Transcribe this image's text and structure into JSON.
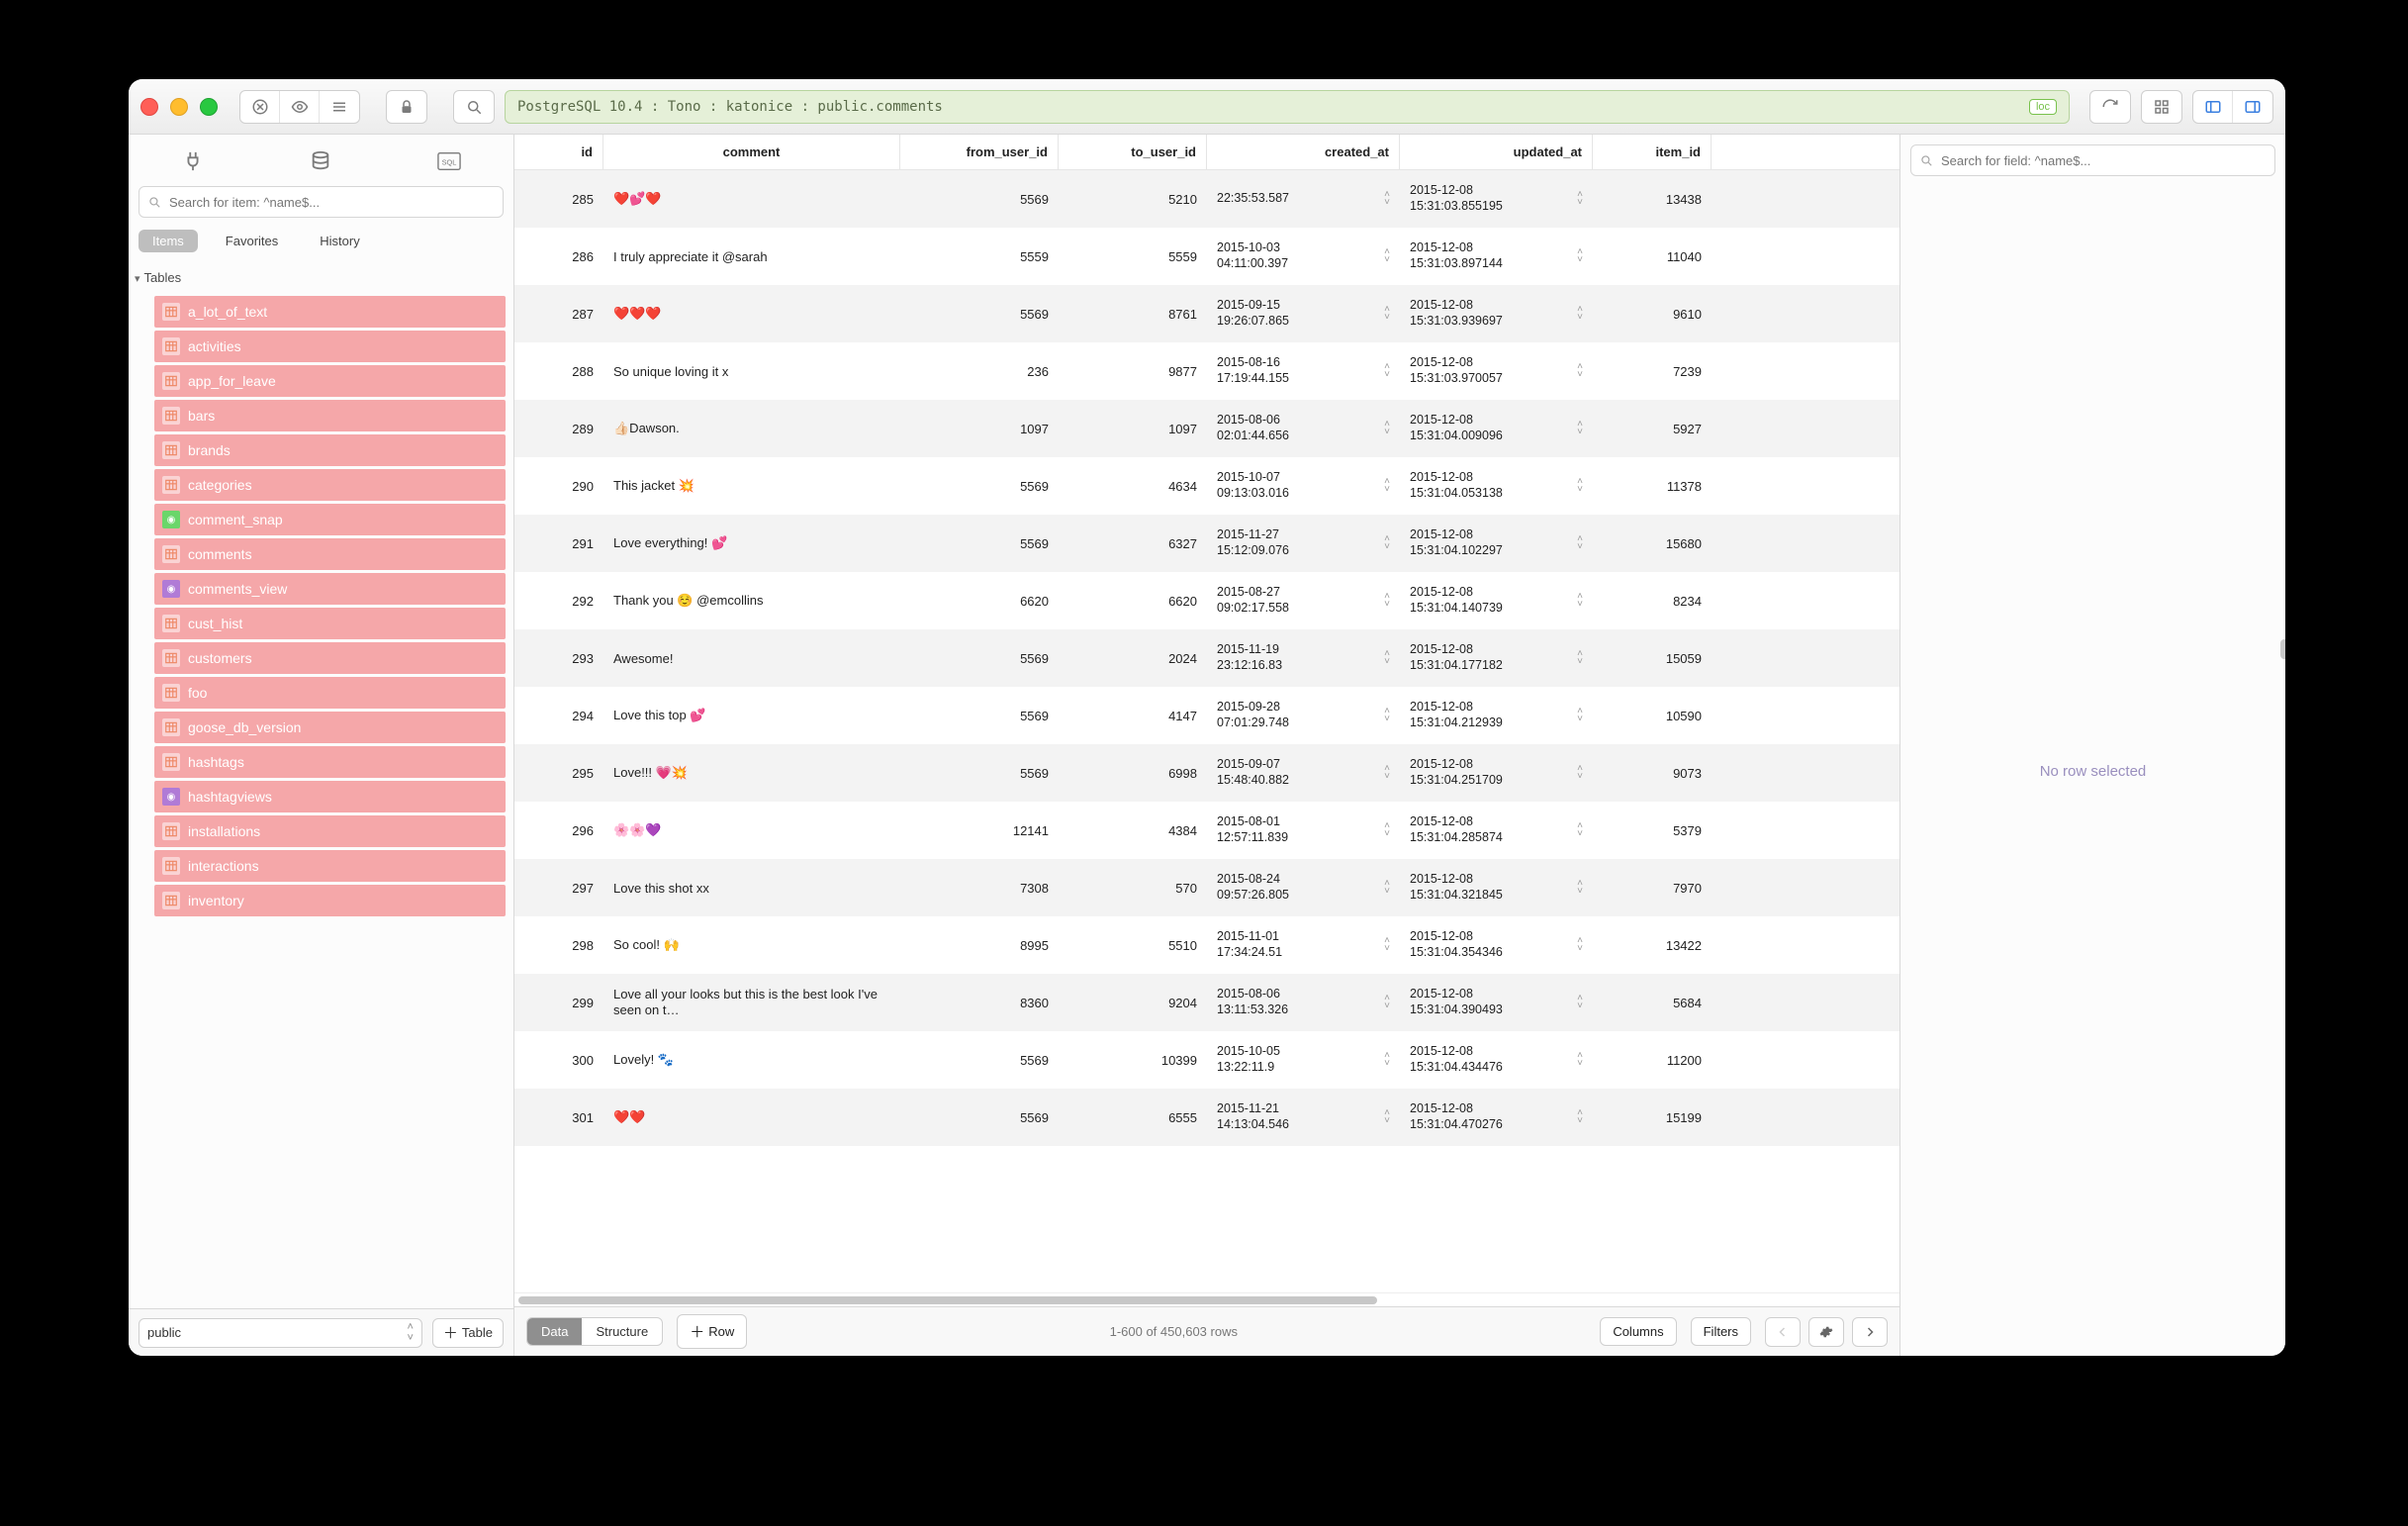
{
  "titlebar": {
    "connection": "PostgreSQL 10.4 : Tono : katonice : public.comments",
    "badge": "loc"
  },
  "sidebar": {
    "search_placeholder": "Search for item: ^name$...",
    "tabs": {
      "items": "Items",
      "favorites": "Favorites",
      "history": "History"
    },
    "section": "Tables",
    "schema": "public",
    "add_table": "Table",
    "tables": [
      {
        "name": "a_lot_of_text",
        "kind": "table"
      },
      {
        "name": "activities",
        "kind": "table"
      },
      {
        "name": "app_for_leave",
        "kind": "table"
      },
      {
        "name": "bars",
        "kind": "table"
      },
      {
        "name": "brands",
        "kind": "table"
      },
      {
        "name": "categories",
        "kind": "table"
      },
      {
        "name": "comment_snap",
        "kind": "snap"
      },
      {
        "name": "comments",
        "kind": "table"
      },
      {
        "name": "comments_view",
        "kind": "view"
      },
      {
        "name": "cust_hist",
        "kind": "table"
      },
      {
        "name": "customers",
        "kind": "table"
      },
      {
        "name": "foo",
        "kind": "table"
      },
      {
        "name": "goose_db_version",
        "kind": "table"
      },
      {
        "name": "hashtags",
        "kind": "table"
      },
      {
        "name": "hashtagviews",
        "kind": "view"
      },
      {
        "name": "installations",
        "kind": "table"
      },
      {
        "name": "interactions",
        "kind": "table"
      },
      {
        "name": "inventory",
        "kind": "table"
      }
    ]
  },
  "grid": {
    "columns": [
      "id",
      "comment",
      "from_user_id",
      "to_user_id",
      "created_at",
      "updated_at",
      "item_id"
    ],
    "rows": [
      {
        "id": 285,
        "comment": "❤️💕❤️",
        "from_user_id": 5569,
        "to_user_id": 5210,
        "created_at": "22:35:53.587",
        "updated_at": "2015-12-08\n15:31:03.855195",
        "item_id": "13438"
      },
      {
        "id": 286,
        "comment": "I truly appreciate it @sarah",
        "from_user_id": 5559,
        "to_user_id": 5559,
        "created_at": "2015-10-03\n04:11:00.397",
        "updated_at": "2015-12-08\n15:31:03.897144",
        "item_id": "11040"
      },
      {
        "id": 287,
        "comment": "❤️❤️❤️",
        "from_user_id": 5569,
        "to_user_id": 8761,
        "created_at": "2015-09-15\n19:26:07.865",
        "updated_at": "2015-12-08\n15:31:03.939697",
        "item_id": "9610"
      },
      {
        "id": 288,
        "comment": "So unique loving it x",
        "from_user_id": 236,
        "to_user_id": 9877,
        "created_at": "2015-08-16\n17:19:44.155",
        "updated_at": "2015-12-08\n15:31:03.970057",
        "item_id": "7239"
      },
      {
        "id": 289,
        "comment": "👍🏻Dawson.",
        "from_user_id": 1097,
        "to_user_id": 1097,
        "created_at": "2015-08-06\n02:01:44.656",
        "updated_at": "2015-12-08\n15:31:04.009096",
        "item_id": "5927"
      },
      {
        "id": 290,
        "comment": "This jacket 💥",
        "from_user_id": 5569,
        "to_user_id": 4634,
        "created_at": "2015-10-07\n09:13:03.016",
        "updated_at": "2015-12-08\n15:31:04.053138",
        "item_id": "11378"
      },
      {
        "id": 291,
        "comment": "Love everything! 💕",
        "from_user_id": 5569,
        "to_user_id": 6327,
        "created_at": "2015-11-27\n15:12:09.076",
        "updated_at": "2015-12-08\n15:31:04.102297",
        "item_id": "15680"
      },
      {
        "id": 292,
        "comment": "Thank you ☺️ @emcollins",
        "from_user_id": 6620,
        "to_user_id": 6620,
        "created_at": "2015-08-27\n09:02:17.558",
        "updated_at": "2015-12-08\n15:31:04.140739",
        "item_id": "8234"
      },
      {
        "id": 293,
        "comment": "Awesome!",
        "from_user_id": 5569,
        "to_user_id": 2024,
        "created_at": "2015-11-19\n23:12:16.83",
        "updated_at": "2015-12-08\n15:31:04.177182",
        "item_id": "15059"
      },
      {
        "id": 294,
        "comment": "Love this top 💕",
        "from_user_id": 5569,
        "to_user_id": 4147,
        "created_at": "2015-09-28\n07:01:29.748",
        "updated_at": "2015-12-08\n15:31:04.212939",
        "item_id": "10590"
      },
      {
        "id": 295,
        "comment": "Love!!! 💗💥",
        "from_user_id": 5569,
        "to_user_id": 6998,
        "created_at": "2015-09-07\n15:48:40.882",
        "updated_at": "2015-12-08\n15:31:04.251709",
        "item_id": "9073"
      },
      {
        "id": 296,
        "comment": "🌸🌸💜",
        "from_user_id": 12141,
        "to_user_id": 4384,
        "created_at": "2015-08-01\n12:57:11.839",
        "updated_at": "2015-12-08\n15:31:04.285874",
        "item_id": "5379"
      },
      {
        "id": 297,
        "comment": "Love this shot xx",
        "from_user_id": 7308,
        "to_user_id": 570,
        "created_at": "2015-08-24\n09:57:26.805",
        "updated_at": "2015-12-08\n15:31:04.321845",
        "item_id": "7970"
      },
      {
        "id": 298,
        "comment": "So cool! 🙌",
        "from_user_id": 8995,
        "to_user_id": 5510,
        "created_at": "2015-11-01\n17:34:24.51",
        "updated_at": "2015-12-08\n15:31:04.354346",
        "item_id": "13422"
      },
      {
        "id": 299,
        "comment": "Love all your looks but this is the best look I've seen on t…",
        "from_user_id": 8360,
        "to_user_id": 9204,
        "created_at": "2015-08-06\n13:11:53.326",
        "updated_at": "2015-12-08\n15:31:04.390493",
        "item_id": "5684"
      },
      {
        "id": 300,
        "comment": "Lovely! 🐾",
        "from_user_id": 5569,
        "to_user_id": 10399,
        "created_at": "2015-10-05\n13:22:11.9",
        "updated_at": "2015-12-08\n15:31:04.434476",
        "item_id": "11200"
      },
      {
        "id": 301,
        "comment": "❤️❤️",
        "from_user_id": 5569,
        "to_user_id": 6555,
        "created_at": "2015-11-21\n14:13:04.546",
        "updated_at": "2015-12-08\n15:31:04.470276",
        "item_id": "15199"
      }
    ]
  },
  "footer": {
    "data": "Data",
    "structure": "Structure",
    "add_row": "Row",
    "count": "1-600 of 450,603 rows",
    "columns": "Columns",
    "filters": "Filters"
  },
  "rightpanel": {
    "search_placeholder": "Search for field: ^name$...",
    "empty": "No row selected"
  }
}
